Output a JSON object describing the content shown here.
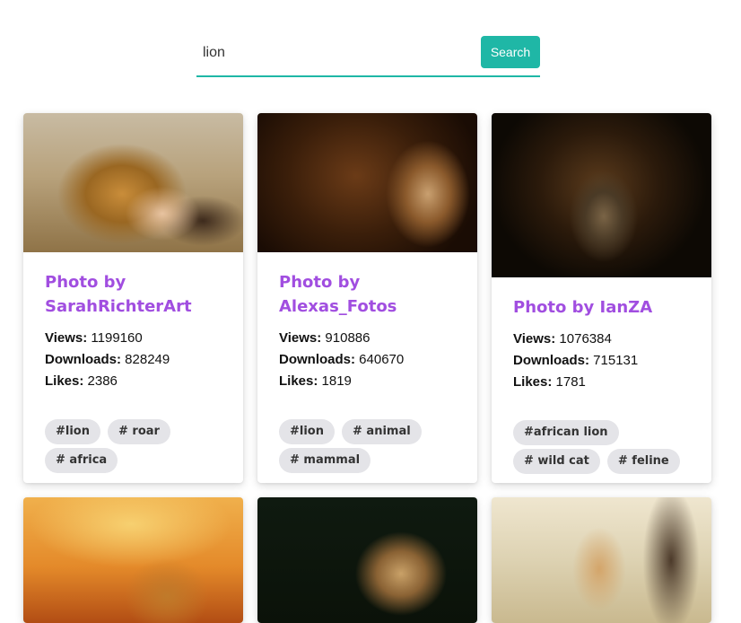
{
  "search": {
    "value": "lion",
    "button_label": "Search",
    "accent_color": "#1fb7a6"
  },
  "cards": [
    {
      "title": "Photo by SarahRichterArt",
      "views_label": "Views:",
      "views": "1199160",
      "downloads_label": "Downloads:",
      "downloads": "828249",
      "likes_label": "Likes:",
      "likes": "2386",
      "tags": [
        "#lion",
        "# roar",
        "# africa"
      ]
    },
    {
      "title": "Photo by Alexas_Fotos",
      "views_label": "Views:",
      "views": "910886",
      "downloads_label": "Downloads:",
      "downloads": "640670",
      "likes_label": "Likes:",
      "likes": "1819",
      "tags": [
        "#lion",
        "# animal",
        "# mammal"
      ]
    },
    {
      "title": "Photo by IanZA",
      "views_label": "Views:",
      "views": "1076384",
      "downloads_label": "Downloads:",
      "downloads": "715131",
      "likes_label": "Likes:",
      "likes": "1781",
      "tags": [
        "#african lion",
        "# wild cat",
        "# feline"
      ]
    }
  ],
  "colors": {
    "title": "#a14ee0",
    "tag_bg": "#e4e4e8"
  }
}
